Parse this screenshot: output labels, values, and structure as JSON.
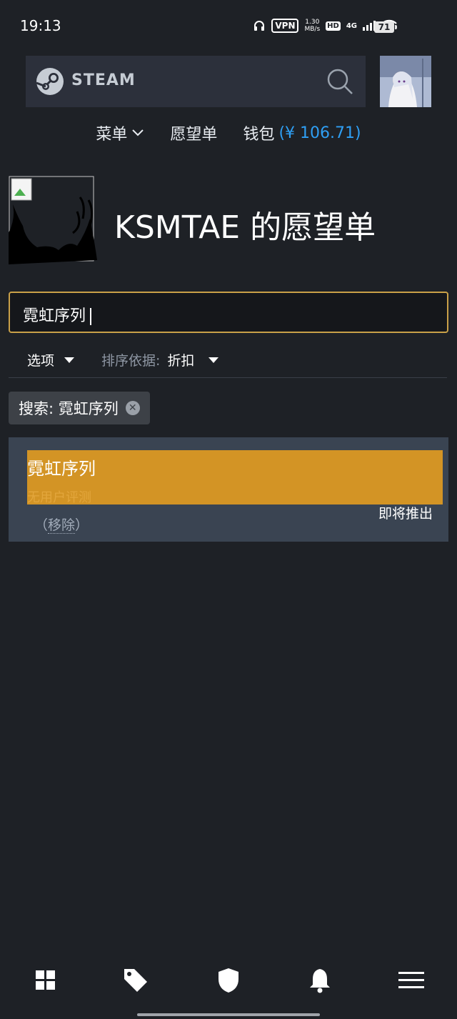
{
  "status_bar": {
    "time": "19:13",
    "vpn": "VPN",
    "net_speed_value": "1.30",
    "net_speed_unit": "MB/s",
    "hd": "HD",
    "network": "4G",
    "battery": "71"
  },
  "header": {
    "logo_text": "STEAM",
    "search_icon": "search-icon"
  },
  "nav": {
    "menu_label": "菜单",
    "wishlist_label": "愿望单",
    "wallet_label": "钱包",
    "wallet_amount": "(¥ 106.71)"
  },
  "profile": {
    "title": "KSMTAE 的愿望单"
  },
  "search": {
    "value": "霓虹序列"
  },
  "filters": {
    "options_label": "选项",
    "sort_label": "排序依据:",
    "sort_value": "折扣"
  },
  "active_filter": {
    "label": "搜索: 霓虹序列"
  },
  "results": [
    {
      "name": "霓虹序列",
      "review": "无用户评测",
      "release": "即将推出",
      "remove_open": "（",
      "remove_label": "移除",
      "remove_close": "）"
    }
  ],
  "bottom_nav": [
    "grid-icon",
    "tag-icon",
    "shield-icon",
    "bell-icon",
    "menu-icon"
  ],
  "colors": {
    "background": "#1e2126",
    "accent_gold": "#d39425",
    "wallet_blue": "#2f9ff4",
    "result_bg": "#3a4452"
  }
}
